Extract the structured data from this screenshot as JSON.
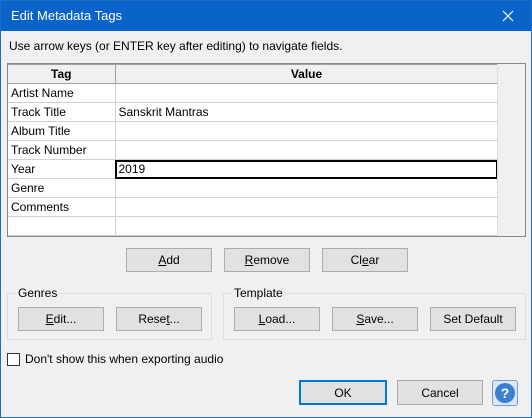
{
  "window": {
    "title": "Edit Metadata Tags",
    "close_icon": "close-icon"
  },
  "hint": "Use arrow keys (or ENTER key after editing) to navigate fields.",
  "grid": {
    "columns": [
      "Tag",
      "Value"
    ],
    "rows": [
      {
        "tag": "Artist Name",
        "value": ""
      },
      {
        "tag": "Track Title",
        "value": "Sanskrit Mantras"
      },
      {
        "tag": "Album Title",
        "value": ""
      },
      {
        "tag": "Track Number",
        "value": ""
      },
      {
        "tag": "Year",
        "value": "2019"
      },
      {
        "tag": "Genre",
        "value": ""
      },
      {
        "tag": "Comments",
        "value": ""
      },
      {
        "tag": "",
        "value": ""
      }
    ]
  },
  "buttons": {
    "add_prefix": "",
    "add_u": "A",
    "add_rest": "dd",
    "remove_prefix": "",
    "remove_u": "R",
    "remove_rest": "emove",
    "clear_prefix": "Cl",
    "clear_u": "e",
    "clear_rest": "ar"
  },
  "genres": {
    "legend": "Genres",
    "edit_prefix": "",
    "edit_u": "E",
    "edit_rest": "dit...",
    "reset_prefix": "Rese",
    "reset_u": "t",
    "reset_rest": "..."
  },
  "template": {
    "legend": "Template",
    "load_prefix": "",
    "load_u": "L",
    "load_rest": "oad...",
    "save_prefix": "",
    "save_u": "S",
    "save_rest": "ave...",
    "set_default": "Set Default"
  },
  "dont_show": {
    "label": "Don't show this when exporting audio",
    "checked": false
  },
  "footer": {
    "ok": "OK",
    "cancel": "Cancel",
    "help": "?"
  }
}
